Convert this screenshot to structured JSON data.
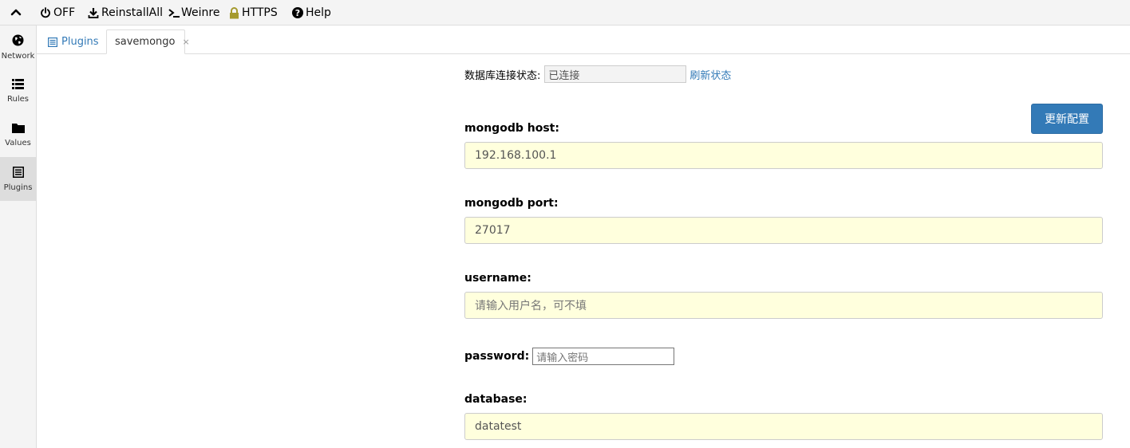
{
  "menubar": {
    "collapse_icon": "chevron-up-icon",
    "items": [
      {
        "label": "OFF",
        "icon": "power-icon"
      },
      {
        "label": "ReinstallAll",
        "icon": "download-icon"
      },
      {
        "label": "Weinre",
        "icon": "terminal-icon"
      },
      {
        "label": "HTTPS",
        "icon": "lock-icon"
      },
      {
        "label": "Help",
        "icon": "question-circle-icon"
      }
    ]
  },
  "sidebar": {
    "items": [
      {
        "label": "Network",
        "icon": "globe-icon"
      },
      {
        "label": "Rules",
        "icon": "list-icon"
      },
      {
        "label": "Values",
        "icon": "folder-icon"
      },
      {
        "label": "Plugins",
        "icon": "list-alt-icon",
        "active": true
      }
    ]
  },
  "tabs": [
    {
      "label": "Plugins",
      "icon": "list-alt-icon"
    },
    {
      "label": "savemongo",
      "close": "×",
      "active": true
    }
  ],
  "status": {
    "label": "数据库连接状态:",
    "value": "已连接",
    "refresh_label": "刷新状态"
  },
  "update_button_label": "更新配置",
  "form": {
    "host": {
      "label": "mongodb host:",
      "value": "192.168.100.1"
    },
    "port": {
      "label": "mongodb port:",
      "value": "27017"
    },
    "username": {
      "label": "username:",
      "value": "",
      "placeholder": "请输入用户名，可不填"
    },
    "password": {
      "label": "password:",
      "value": "",
      "placeholder": "请输入密码"
    },
    "database": {
      "label": "database:",
      "value": "datatest"
    }
  },
  "colors": {
    "accent": "#337ab7",
    "input_bg": "#ffffdd",
    "menubar_bg": "#f4f4f4",
    "lock_icon": "#a59a2e"
  }
}
